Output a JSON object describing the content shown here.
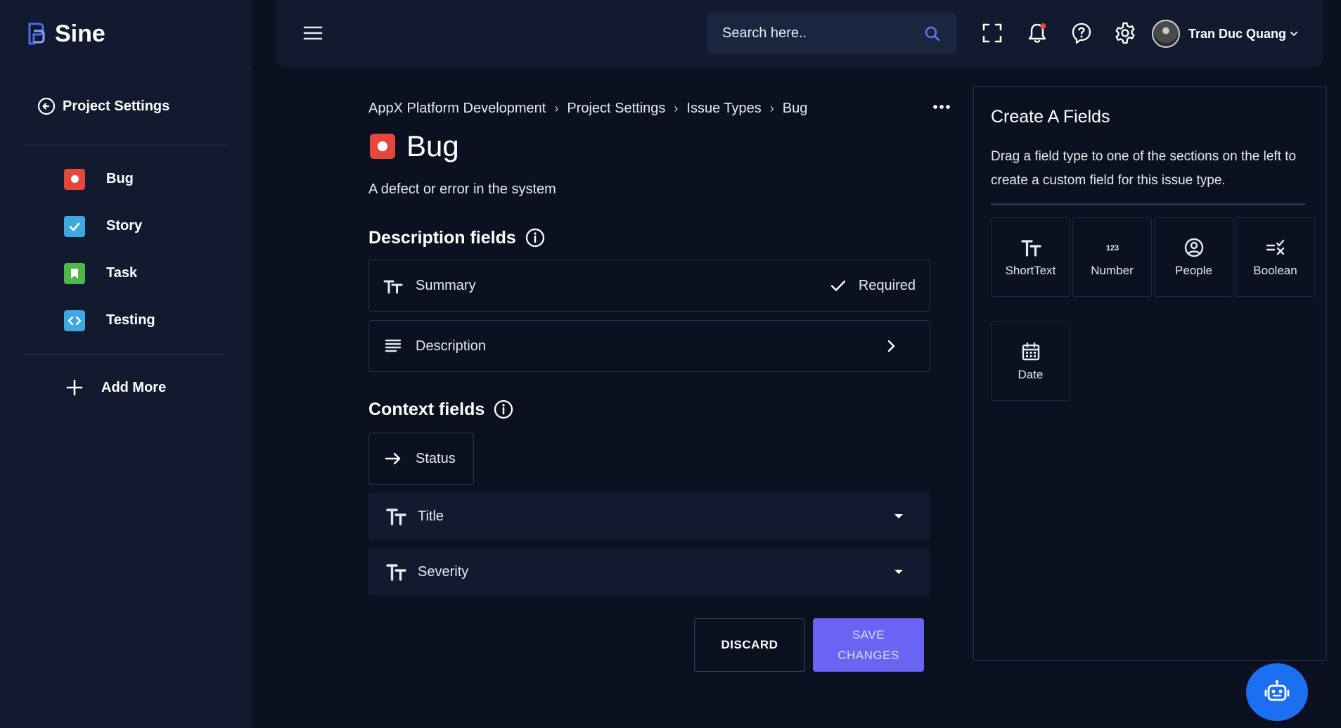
{
  "brand": {
    "name": "Sine"
  },
  "sidebar": {
    "back_label": "Project Settings",
    "issue_types": [
      {
        "label": "Bug",
        "color": "#e5483b",
        "icon": "bug-dot-icon"
      },
      {
        "label": "Story",
        "color": "#3fa8e0",
        "icon": "check-icon"
      },
      {
        "label": "Task",
        "color": "#4fb848",
        "icon": "bookmark-icon"
      },
      {
        "label": "Testing",
        "color": "#3fa8e0",
        "icon": "code-icon"
      }
    ],
    "add_label": "Add More"
  },
  "header": {
    "search_placeholder": "Search here..",
    "user_name": "Tran Duc Quang",
    "notification_dot_color": "#ef4444"
  },
  "main": {
    "breadcrumb": [
      "AppX Platform Development",
      "Project Settings",
      "Issue Types",
      "Bug"
    ],
    "title": "Bug",
    "description": "A defect or error in the system",
    "description_fields_title": "Description fields",
    "summary_label": "Summary",
    "required_label": "Required",
    "description_label": "Description",
    "context_fields_title": "Context fields",
    "status_label": "Status",
    "title_select_label": "Title",
    "severity_select_label": "Severity",
    "discard_label": "DISCARD",
    "save_label": "SAVE CHANGES"
  },
  "panel": {
    "title": "Create A Fields",
    "description": "Drag a field type to one of the sections on the left to create a custom field for this issue type.",
    "field_types": [
      {
        "label": "ShortText",
        "icon": "text-size-icon"
      },
      {
        "label": "Number",
        "icon": "number-icon"
      },
      {
        "label": "People",
        "icon": "person-icon"
      },
      {
        "label": "Boolean",
        "icon": "boolean-icon"
      },
      {
        "label": "Date",
        "icon": "calendar-icon"
      }
    ]
  },
  "colors": {
    "background": "#0b1120",
    "surface": "#111a2e",
    "accent": "#6b63f2",
    "bot": "#1d6ff2"
  }
}
